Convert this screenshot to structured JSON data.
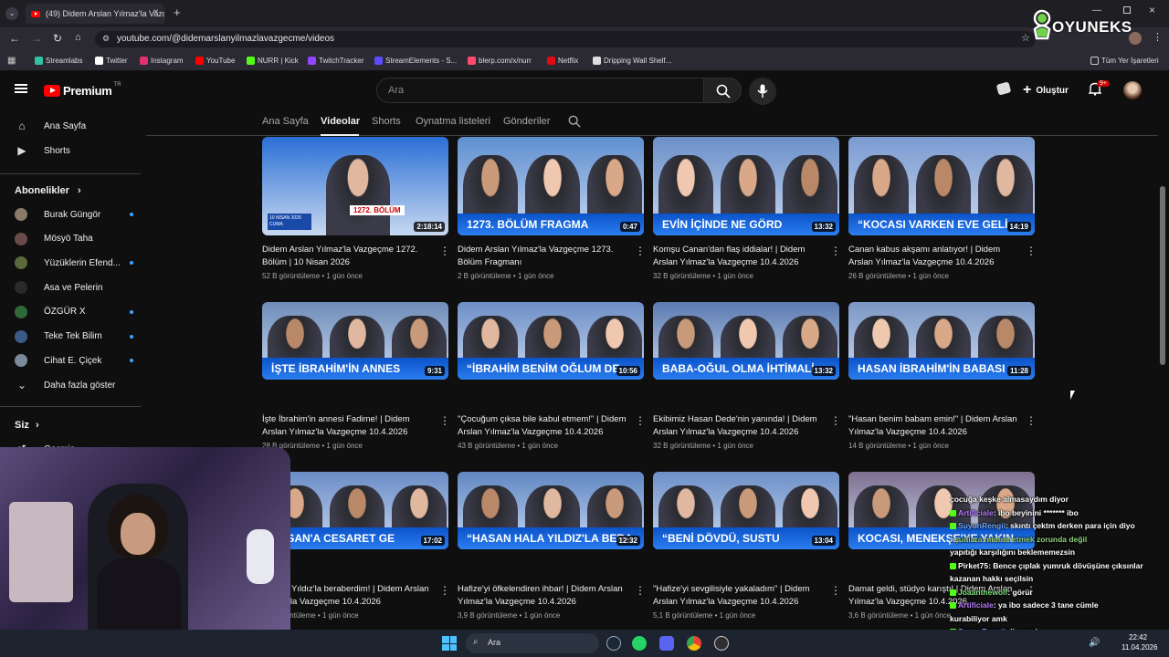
{
  "browser": {
    "tab_title": "(49) Didem Arslan Yılmaz'la Vazç",
    "url": "youtube.com/@didemarslanyilmazlavazgecme/videos",
    "bookmarks": [
      {
        "label": "Streamlabs",
        "color": "#31c3a2"
      },
      {
        "label": "Twitter",
        "color": "#ffffff"
      },
      {
        "label": "Instagram",
        "color": "#e1306c"
      },
      {
        "label": "YouTube",
        "color": "#ff0000"
      },
      {
        "label": "NURR | Kick",
        "color": "#53fc18"
      },
      {
        "label": "TwitchTracker",
        "color": "#9146ff"
      },
      {
        "label": "StreamElements - S...",
        "color": "#5c4bff"
      },
      {
        "label": "blerp.com/x/nurr",
        "color": "#ff4a6e"
      },
      {
        "label": "Netflix",
        "color": "#e50914"
      },
      {
        "label": "Dripping Wall Shelf...",
        "color": "#dddddd"
      }
    ],
    "all_bookmarks": "Tüm Yer İşaretleri"
  },
  "header": {
    "logo_text": "Premium",
    "logo_badge": "TR",
    "search_placeholder": "Ara",
    "create_label": "Oluştur",
    "notif_count": "9+"
  },
  "sidebar": {
    "top": [
      {
        "label": "Ana Sayfa",
        "icon": "home-icon"
      },
      {
        "label": "Shorts",
        "icon": "shorts-icon"
      }
    ],
    "subs_heading": "Abonelikler",
    "subs": [
      {
        "label": "Burak Güngör",
        "color": "#8a7a6a",
        "dot": true
      },
      {
        "label": "Mösyö Taha",
        "color": "#6a4a4a",
        "dot": false
      },
      {
        "label": "Yüzüklerin Efend...",
        "color": "#5a6a3a",
        "dot": true
      },
      {
        "label": "Asa ve Pelerin",
        "color": "#2a2a2a",
        "dot": false
      },
      {
        "label": "ÖZGÜR X",
        "color": "#2f6a3a",
        "dot": true
      },
      {
        "label": "Teke Tek Bilim",
        "color": "#3a5a8a",
        "dot": true
      },
      {
        "label": "Cihat E. Çiçek",
        "color": "#7a8a9a",
        "dot": true
      }
    ],
    "show_more": "Daha fazla göster",
    "you_heading": "Siz",
    "history": "Geçmiş",
    "bottom_heading": "Ke"
  },
  "channel_tabs": [
    "Ana Sayfa",
    "Videolar",
    "Shorts",
    "Oynatma listeleri",
    "Gönderiler"
  ],
  "videos": [
    {
      "band": "",
      "duration": "2:18:14",
      "title": "Didem Arslan Yılmaz'la Vazgeçme 1272. Bölüm | 10 Nisan 2026",
      "views": "52 B görüntüleme",
      "age": "1 gün önce",
      "bg": "#2a6fd6",
      "label": "1272. BÖLÜM",
      "date": "10 NİSAN 2026 CUMA"
    },
    {
      "band": "1273. BÖLÜM FRAGMA",
      "duration": "0:47",
      "title": "Didem Arslan Yılmaz'la Vazgeçme 1273. Bölüm Fragmanı",
      "views": "2 B görüntüleme",
      "age": "1 gün önce",
      "bg": "#5f8fd0"
    },
    {
      "band": "EVİN İÇİNDE NE GÖRD",
      "duration": "13:32",
      "title": "Komşu Canan'dan flaş iddialar! | Didem Arslan Yılmaz'la Vazgeçme 10.4.2026",
      "views": "32 B görüntüleme",
      "age": "1 gün önce",
      "bg": "#6a8fc8"
    },
    {
      "band": "“KOCASI VARKEN EVE GELİ",
      "duration": "14:19",
      "title": "Canan kabus akşamı anlatıyor! | Didem Arslan Yılmaz'la Vazgeçme 10.4.2026",
      "views": "26 B görüntüleme",
      "age": "1 gün önce",
      "bg": "#7a9ad0"
    },
    {
      "band": "İŞTE İBRAHİM'İN ANNES",
      "duration": "9:31",
      "title": "İşte İbrahim'in annesi Fadime! | Didem Arslan Yılmaz'la Vazgeçme 10.4.2026",
      "views": "28 B görüntüleme",
      "age": "1 gün önce",
      "bg": "#6f8cb8"
    },
    {
      "band": "“İBRAHİM BENİM OĞLUM DE",
      "duration": "10:56",
      "title": "\"Çocuğum çıksa bile kabul etmem!\" | Didem Arslan Yılmaz'la Vazgeçme 10.4.2026",
      "views": "43 B görüntüleme",
      "age": "1 gün önce",
      "bg": "#6d8ec6"
    },
    {
      "band": "BABA-OĞUL OLMA İHTİMALİ",
      "duration": "13:32",
      "title": "Ekibimiz Hasan Dede'nin yanında! | Didem Arslan Yılmaz'la Vazgeçme 10.4.2026",
      "views": "32 B görüntüleme",
      "age": "1 gün önce",
      "bg": "#5a7ab0"
    },
    {
      "band": "HASAN İBRAHİM'İN BABASI",
      "duration": "11:28",
      "title": "\"Hasan benim babam emin!\" | Didem Arslan Yılmaz'la Vazgeçme 10.4.2026",
      "views": "14 B görüntüleme",
      "age": "1 gün önce",
      "bg": "#7b97c4"
    },
    {
      "band": "HASAN'A CESARET GE",
      "duration": "17:02",
      "title": "n: Evet Yıldız'la beraberdim! | Didem Arslan Yılmaz'la Vazgeçme 10.4.2026",
      "views": "1 B görüntüleme",
      "age": "1 gün önce",
      "bg": "#6a8cc6"
    },
    {
      "band": "“HASAN HALA YILDIZ'LA BERA",
      "duration": "12:32",
      "title": "Hafize'yi öfkelendiren ihbar! | Didem Arslan Yılmaz'la Vazgeçme 10.4.2026",
      "views": "3,9 B görüntüleme",
      "age": "1 gün önce",
      "bg": "#5f86c2"
    },
    {
      "band": "“BENİ DÖVDÜ, SUSTU",
      "duration": "13:04",
      "title": "\"Hafize'yi sevgilisiyle yakaladım\" | Didem Arslan Yılmaz'la Vazgeçme 10.4.2026",
      "views": "5,1 B görüntüleme",
      "age": "1 gün önce",
      "bg": "#6d90c8"
    },
    {
      "band": "KOCASI, MENEKŞE'YE YAKIN",
      "duration": "",
      "title": "Damat geldi, stüdyo karıştı! | Didem Arslan Yılmaz'la Vazgeçme 10.4.2026",
      "views": "3,6 B görüntüleme",
      "age": "1 gün önce",
      "bg": "#7f6f8f"
    }
  ],
  "chat": [
    {
      "user": "",
      "text": "çocuğa keşke almasaydım diyor",
      "color": "#ffffff"
    },
    {
      "user": "Artificiale",
      "text": ": ibo beyinini ******* ibo",
      "color": "#b57aff"
    },
    {
      "user": "SuyunRengii",
      "text": ": skıntı çektm derken para için diyo",
      "color": "#6fa8ff"
    },
    {
      "user": "",
      "text": ": şunlara minnet etmek zorunda değil",
      "color": "#8fd07a"
    },
    {
      "user": "",
      "text": "yapıtığı ",
      "color": "#ffffff",
      "rest": "karşılığını beklememezsin"
    },
    {
      "user": "Pirket75",
      "text": ": Bence çıplak yumruk dövüşüne çıksınlar",
      "color": "#ffffff"
    },
    {
      "user": "",
      "text": "kazanan hakkı seçilsin",
      "color": "#ffffff"
    },
    {
      "user": "Joaanthewolf",
      "text": ": görür",
      "color": "#7fe07f"
    },
    {
      "user": "Artificiale",
      "text": ": ya ibo sadece 3 tane cümle",
      "color": "#b57aff"
    },
    {
      "user": "",
      "text": "kurabiliyor amk",
      "color": "#ffffff"
    },
    {
      "user": "SuyunRengii",
      "text": ": ibo mal",
      "color": "#6fa8ff"
    }
  ],
  "taskbar": {
    "search": "Ara",
    "time": "22:42",
    "date": "11.04.2026"
  },
  "overlay": {
    "brand": "OYUNEKS"
  }
}
